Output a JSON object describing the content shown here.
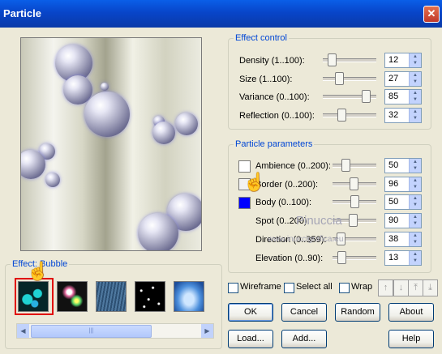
{
  "window": {
    "title": "Particle",
    "close_glyph": "✕"
  },
  "effect_control": {
    "title": "Effect control",
    "rows": [
      {
        "label": "Density (1..100):",
        "value": "12",
        "level": 12,
        "min": 1,
        "max": 100
      },
      {
        "label": "Size (1..100):",
        "value": "27",
        "level": 27,
        "min": 1,
        "max": 100
      },
      {
        "label": "Variance (0..100):",
        "value": "85",
        "level": 85,
        "min": 0,
        "max": 100
      },
      {
        "label": "Reflection (0..100):",
        "value": "32",
        "level": 32,
        "min": 0,
        "max": 100
      }
    ]
  },
  "particle_parameters": {
    "title": "Particle parameters",
    "rows": [
      {
        "label": "Ambience (0..200):",
        "value": "50",
        "level": 50,
        "min": 0,
        "max": 200,
        "swatch": "#ffffff"
      },
      {
        "label": "Border (0..200):",
        "value": "96",
        "level": 96,
        "min": 0,
        "max": 200,
        "swatch": "#f2f2f2"
      },
      {
        "label": "Body (0..100):",
        "value": "50",
        "level": 50,
        "min": 0,
        "max": 100,
        "swatch": "#0000ff"
      },
      {
        "label": "Spot (0..200):",
        "value": "90",
        "level": 90,
        "min": 0,
        "max": 200
      },
      {
        "label": "Direction (0..359):",
        "value": "38",
        "level": 38,
        "min": 0,
        "max": 359
      },
      {
        "label": "Elevation (0..90):",
        "value": "13",
        "level": 13,
        "min": 0,
        "max": 90
      }
    ]
  },
  "effects": {
    "title": "Effect: Bubble",
    "thumbnails": [
      "Bubble",
      "Glow",
      "Rain",
      "Stars",
      "Sky"
    ],
    "selected_index": 0
  },
  "options": {
    "wireframe": "Wireframe",
    "select_all": "Select all",
    "wrap": "Wrap"
  },
  "toolbar_icons": [
    "↑",
    "↓",
    "⤒",
    "⤓"
  ],
  "buttons": {
    "ok": "OK",
    "cancel": "Cancel",
    "random": "Random",
    "about": "About",
    "load": "Load...",
    "add": "Add...",
    "help": "Help"
  },
  "scrollbar": {
    "left_arrow": "◀",
    "right_arrow": "▶",
    "grip": "|||"
  },
  "watermark": {
    "line1": "Pinuccia",
    "line2": "www.inuccigrafica.eu"
  },
  "colors": {
    "accent": "#0046d5",
    "selected_border": "#e00000"
  }
}
